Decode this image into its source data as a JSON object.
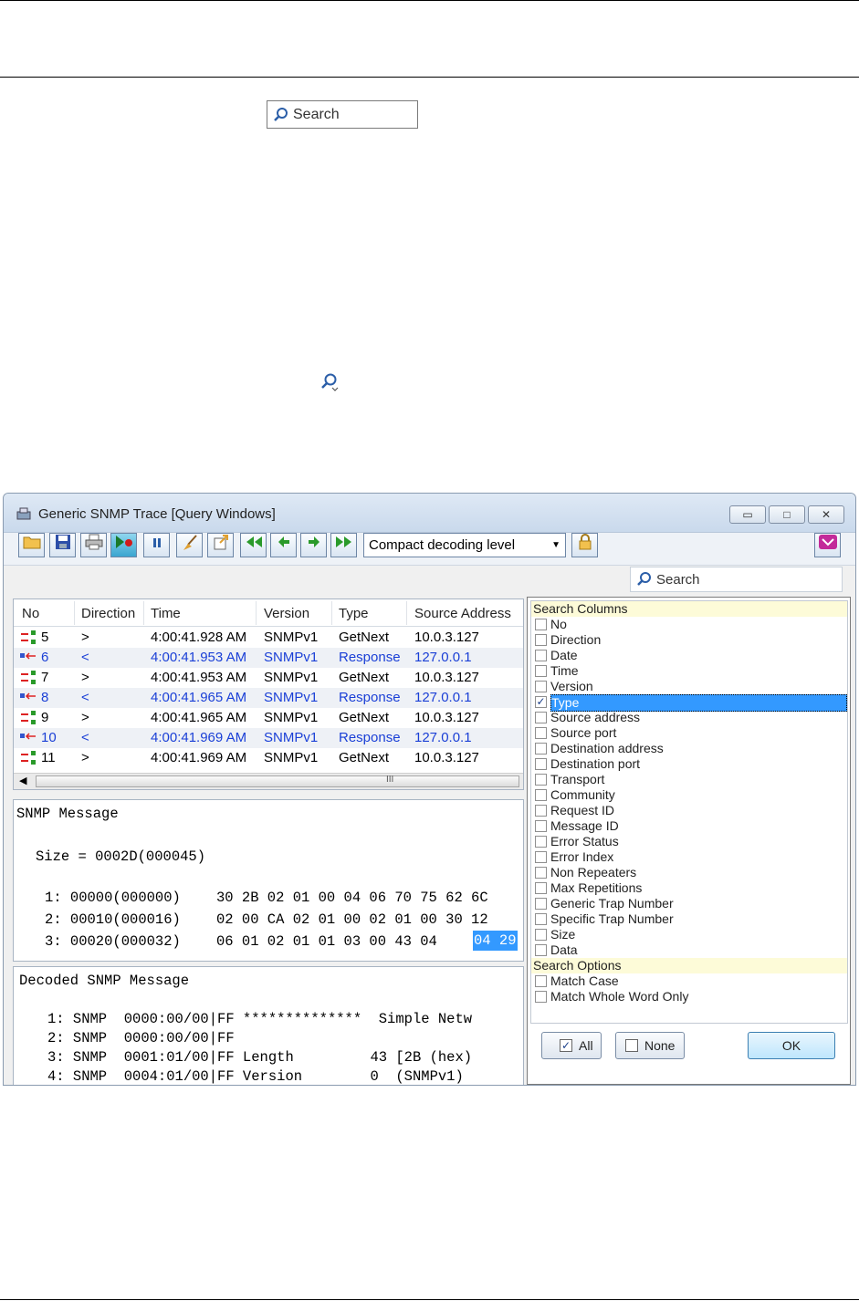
{
  "page": {
    "search_placeholder": "Search"
  },
  "window": {
    "title": "Generic SNMP Trace [Query Windows]",
    "controls": {
      "minimize": "▭",
      "maximize": "□",
      "close": "✕"
    },
    "toolbar": {
      "decoding_level": "Compact decoding level"
    },
    "search_placeholder": "Search"
  },
  "grid": {
    "columns": [
      "No",
      "Direction",
      "Time",
      "Version",
      "Type",
      "Source Address"
    ],
    "rows": [
      {
        "no": "5",
        "dir": ">",
        "time": "4:00:41.928 AM",
        "version": "SNMPv1",
        "type": "GetNext",
        "src": "10.0.3.127",
        "resp": false
      },
      {
        "no": "6",
        "dir": "<",
        "time": "4:00:41.953 AM",
        "version": "SNMPv1",
        "type": "Response",
        "src": "127.0.0.1",
        "resp": true
      },
      {
        "no": "7",
        "dir": ">",
        "time": "4:00:41.953 AM",
        "version": "SNMPv1",
        "type": "GetNext",
        "src": "10.0.3.127",
        "resp": false
      },
      {
        "no": "8",
        "dir": "<",
        "time": "4:00:41.965 AM",
        "version": "SNMPv1",
        "type": "Response",
        "src": "127.0.0.1",
        "resp": true
      },
      {
        "no": "9",
        "dir": ">",
        "time": "4:00:41.965 AM",
        "version": "SNMPv1",
        "type": "GetNext",
        "src": "10.0.3.127",
        "resp": false
      },
      {
        "no": "10",
        "dir": "<",
        "time": "4:00:41.969 AM",
        "version": "SNMPv1",
        "type": "Response",
        "src": "127.0.0.1",
        "resp": true
      },
      {
        "no": "11",
        "dir": ">",
        "time": "4:00:41.969 AM",
        "version": "SNMPv1",
        "type": "GetNext",
        "src": "10.0.3.127",
        "resp": false
      }
    ],
    "scroll_grip": "III"
  },
  "message": {
    "title": "SNMP Message",
    "size": "Size = 0002D(000045)",
    "lines": [
      {
        "addr": "1: 00000(000000)",
        "hex": "30 2B 02 01 00 04 06 70 75 62 6C",
        "hl": ""
      },
      {
        "addr": "2: 00010(000016)",
        "hex": "02 00 CA 02 01 00 02 01 00 30 12",
        "hl": ""
      },
      {
        "addr": "3: 00020(000032)",
        "hex": "06 01 02 01 01 03 00 43 04 ",
        "hl": "04 29"
      }
    ]
  },
  "decoded": {
    "title": "Decoded SNMP Message",
    "lines": [
      "1: SNMP  0000:00/00|FF **************  Simple Netw",
      "2: SNMP  0000:00/00|FF",
      "3: SNMP  0001:01/00|FF Length         43 [2B (hex)",
      "4: SNMP  0004:01/00|FF Version        0  (SNMPv1)"
    ]
  },
  "popup": {
    "columns_header": "Search Columns",
    "columns": [
      {
        "label": "No",
        "checked": false
      },
      {
        "label": "Direction",
        "checked": false
      },
      {
        "label": "Date",
        "checked": false
      },
      {
        "label": "Time",
        "checked": false
      },
      {
        "label": "Version",
        "checked": false
      },
      {
        "label": "Type",
        "checked": true
      },
      {
        "label": "Source address",
        "checked": false
      },
      {
        "label": "Source port",
        "checked": false
      },
      {
        "label": "Destination address",
        "checked": false
      },
      {
        "label": "Destination port",
        "checked": false
      },
      {
        "label": "Transport",
        "checked": false
      },
      {
        "label": "Community",
        "checked": false
      },
      {
        "label": "Request ID",
        "checked": false
      },
      {
        "label": "Message ID",
        "checked": false
      },
      {
        "label": "Error Status",
        "checked": false
      },
      {
        "label": "Error Index",
        "checked": false
      },
      {
        "label": "Non Repeaters",
        "checked": false
      },
      {
        "label": "Max Repetitions",
        "checked": false
      },
      {
        "label": "Generic Trap Number",
        "checked": false
      },
      {
        "label": "Specific Trap Number",
        "checked": false
      },
      {
        "label": "Size",
        "checked": false
      },
      {
        "label": "Data",
        "checked": false
      }
    ],
    "options_header": "Search Options",
    "options": [
      {
        "label": "Match Case",
        "checked": false
      },
      {
        "label": "Match Whole Word Only",
        "checked": false
      }
    ],
    "all_label": "All",
    "none_label": "None",
    "ok_label": "OK"
  }
}
